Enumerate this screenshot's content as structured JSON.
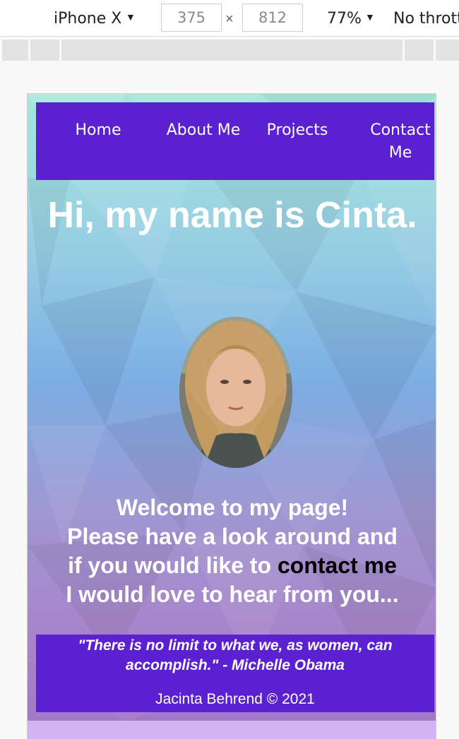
{
  "devtools": {
    "device": "iPhone X",
    "width": "375",
    "height": "812",
    "zoom": "77%",
    "throttle": "No thrott"
  },
  "site": {
    "nav": [
      "Home",
      "About Me",
      "Projects",
      "Contact Me"
    ],
    "hero_title": "Hi, my name is Cinta.",
    "welcome_line1": "Welcome to my page!",
    "welcome_line2": "Please have a look around and",
    "welcome_line3_prefix": "if you would like to ",
    "welcome_link": "contact me",
    "welcome_line4": "I would love to hear from you...",
    "quote": "\"There is no limit to what we, as women, can accomplish.\" - Michelle Obama",
    "copyright": "Jacinta Behrend © 2021"
  },
  "colors": {
    "nav_bg": "#5b21d1",
    "strip": "#d2b4f5"
  }
}
